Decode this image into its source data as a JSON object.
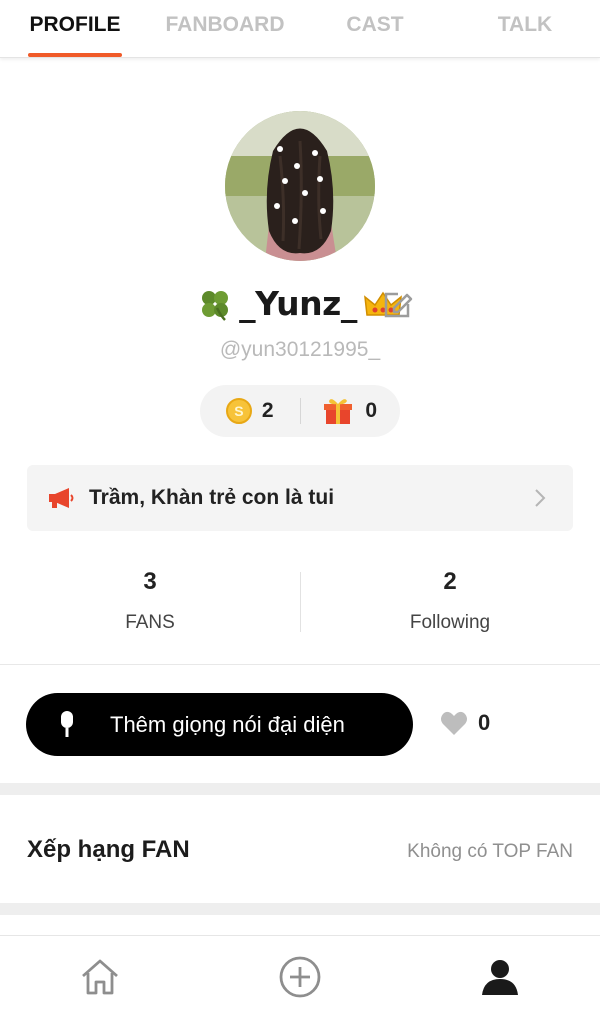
{
  "tabs": [
    {
      "label": "PROFILE",
      "active": true
    },
    {
      "label": "FANBOARD",
      "active": false
    },
    {
      "label": "CAST",
      "active": false
    },
    {
      "label": "TALK",
      "active": false
    }
  ],
  "profile": {
    "name_prefix_icon": "four-leaf-clover",
    "name": "_Yunz_",
    "name_suffix_icon": "crown",
    "handle": "@yun30121995_"
  },
  "counters": {
    "coins": "2",
    "coin_symbol": "S",
    "gifts": "0"
  },
  "status_message": "Trầm, Khàn trẻ con là tui",
  "stats": {
    "fans_count": "3",
    "fans_label": "FANS",
    "following_count": "2",
    "following_label": "Following"
  },
  "voice_button_label": "Thêm giọng nói đại diện",
  "likes_count": "0",
  "fan_ranking": {
    "title": "Xếp hạng FAN",
    "empty_text": "Không có TOP FAN"
  },
  "bottom_nav": [
    "home-icon",
    "add-circle-icon",
    "profile-icon"
  ],
  "colors": {
    "accent": "#f05a28",
    "coin": "#f7c339",
    "voice_button": "#000000"
  }
}
